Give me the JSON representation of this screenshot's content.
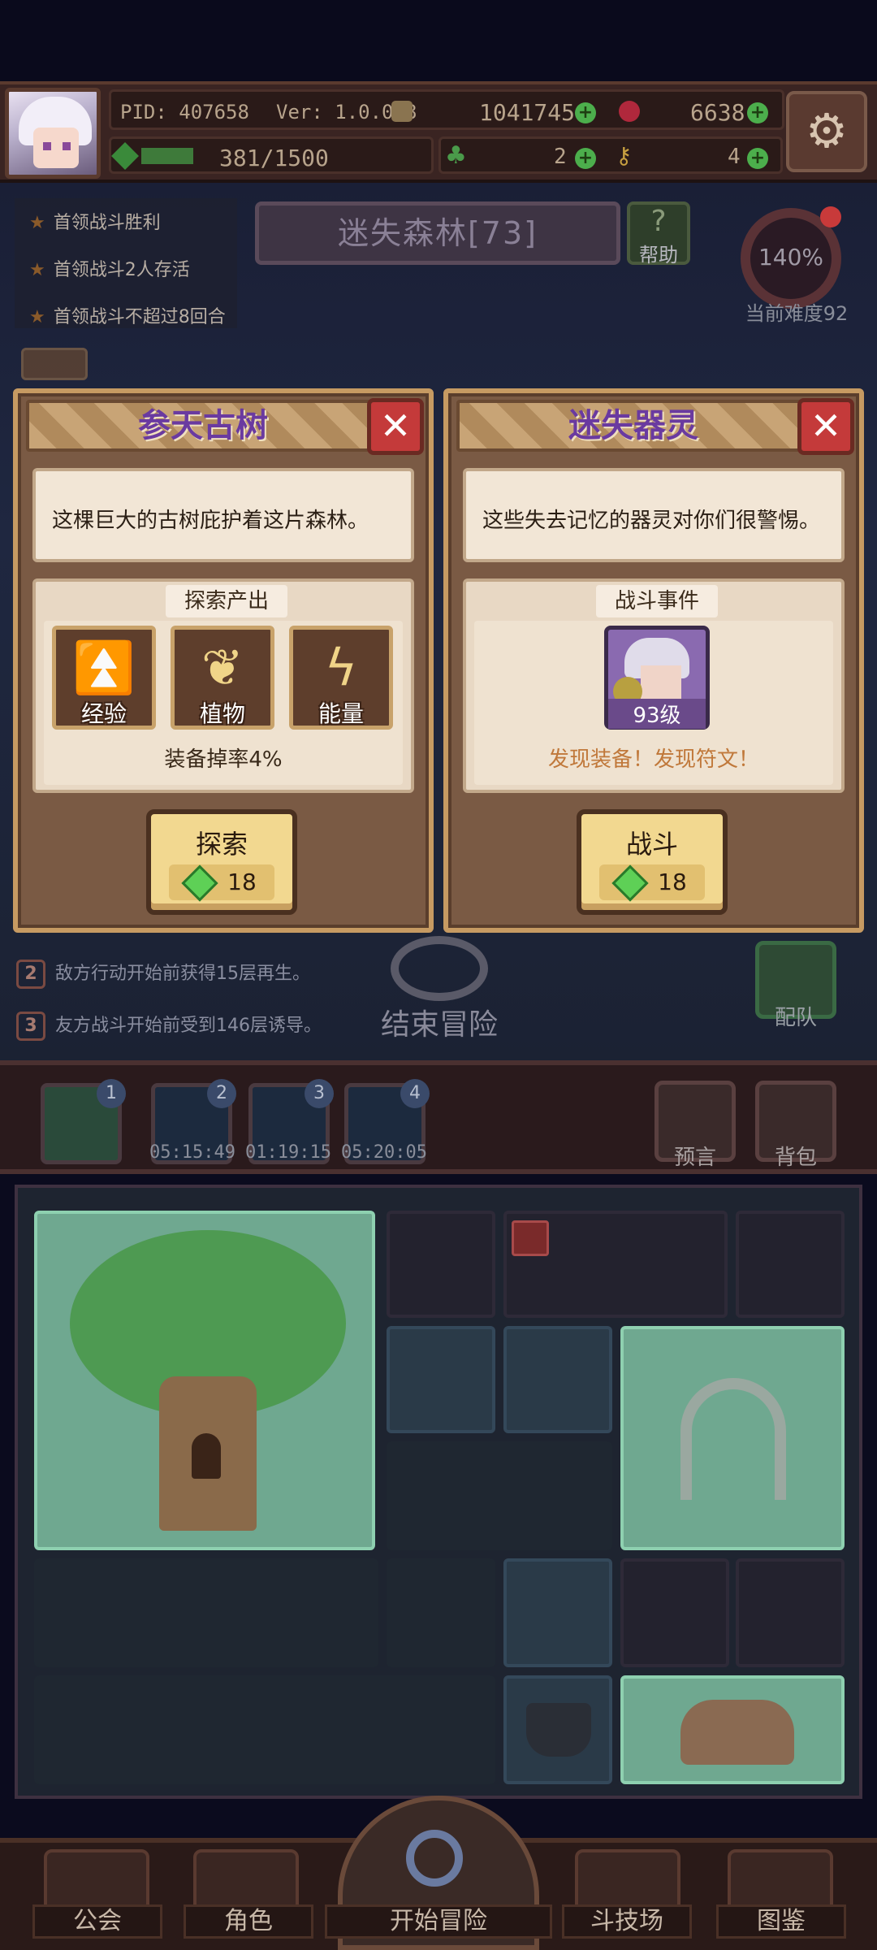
{
  "header": {
    "pid": "PID: 407658",
    "version": "Ver: 1.0.0.8",
    "gold": "1041745",
    "gems": "6638",
    "stamina": "381/1500",
    "clover": "2",
    "key": "4"
  },
  "quests": [
    "首领战斗胜利",
    "首领战斗2人存活",
    "首领战斗不超过8回合"
  ],
  "stage": {
    "name": "迷失森林[73]",
    "help": "帮助"
  },
  "difficulty": {
    "percent": "140%",
    "label": "当前难度92"
  },
  "cards": [
    {
      "title": "参天古树",
      "desc": "这棵巨大的古树庇护着这片森林。",
      "section": "探索产出",
      "rewards": [
        {
          "label": "经验",
          "icon": "chevron-up-icon"
        },
        {
          "label": "植物",
          "icon": "leaf-icon"
        },
        {
          "label": "能量",
          "icon": "lightning-icon"
        }
      ],
      "note": "装备掉率4%",
      "action": "探索",
      "cost": "18"
    },
    {
      "title": "迷失器灵",
      "desc": "这些失去记忆的器灵对你们很警惕。",
      "section": "战斗事件",
      "enemy_level": "93级",
      "note": "发现装备！发现符文！",
      "action": "战斗",
      "cost": "18"
    }
  ],
  "effects": [
    {
      "num": "2",
      "text": "敌方行动开始前获得15层再生。"
    },
    {
      "num": "3",
      "text": "友方战斗开始前受到146层诱导。"
    }
  ],
  "end_adventure": "结束冒险",
  "team": "配队",
  "floors": [
    {
      "badge": "1",
      "timer": ""
    },
    {
      "badge": "2",
      "timer": "05:15:49"
    },
    {
      "badge": "3",
      "timer": "01:19:15"
    },
    {
      "badge": "4",
      "timer": "05:20:05"
    }
  ],
  "side_buttons": {
    "prophecy": "预言",
    "bag": "背包"
  },
  "nav": {
    "guild": "公会",
    "role": "角色",
    "start": "开始冒险",
    "arena": "斗技场",
    "codex": "图鉴"
  },
  "colors": {
    "accent_purple": "#6a3aa0",
    "gem_green": "#5ed056",
    "close_red": "#c43a3a",
    "note_orange": "#c0783a"
  }
}
